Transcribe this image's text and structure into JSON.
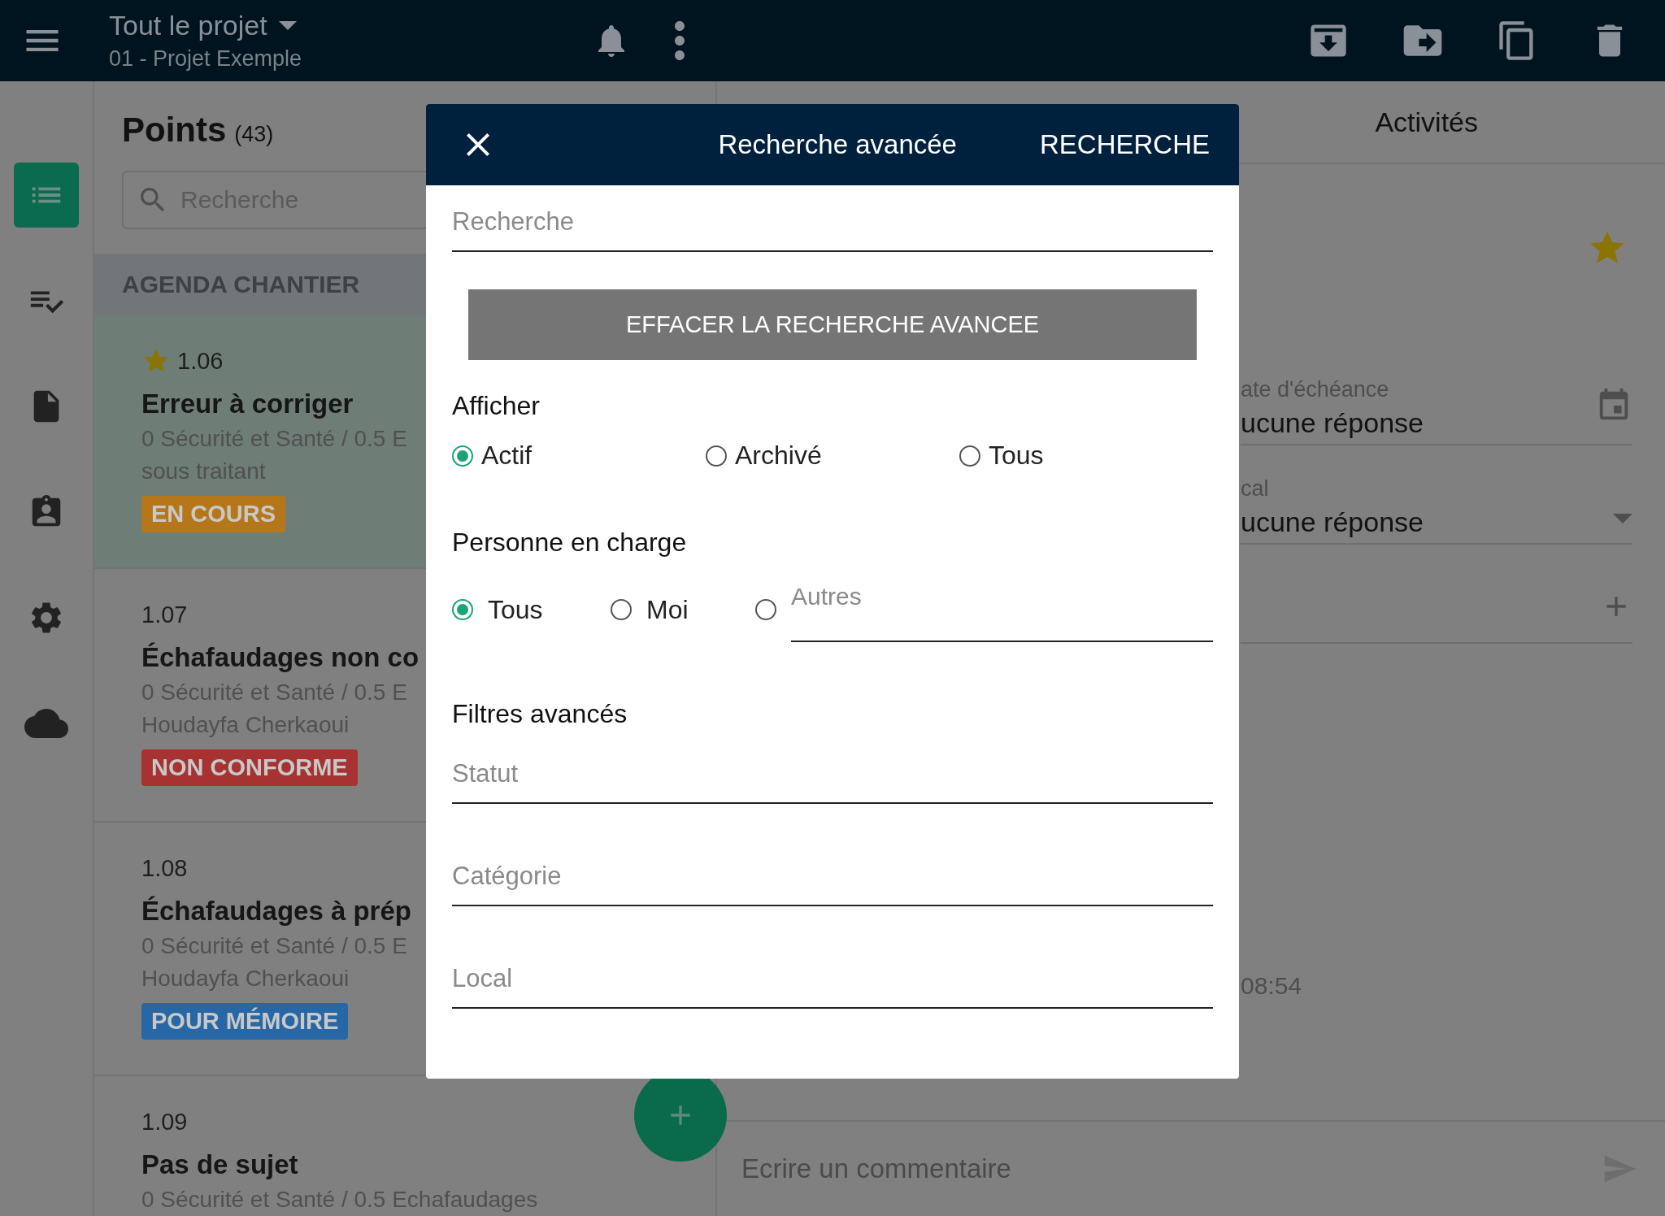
{
  "top_bar": {
    "title": "Tout le projet",
    "subtitle": "01 - Projet Exemple"
  },
  "nav_rail": {
    "items": [
      {
        "kind": "list",
        "selected": true
      },
      {
        "kind": "checklist",
        "selected": false
      },
      {
        "kind": "document",
        "selected": false
      },
      {
        "kind": "contact",
        "selected": false
      },
      {
        "kind": "settings",
        "selected": false
      },
      {
        "kind": "cloud",
        "selected": false
      }
    ]
  },
  "points": {
    "title": "Points",
    "count": "(43)",
    "search": {
      "placeholder": "Recherche"
    },
    "section": "AGENDA CHANTIER",
    "items": [
      {
        "number": "1.06",
        "starred": true,
        "selected": true,
        "title": "Erreur à corriger",
        "lines": [
          "0 Sécurité et Santé / 0.5 E",
          "sous traitant"
        ],
        "status": "EN COURS",
        "color": "#b5771a"
      },
      {
        "number": "1.07",
        "starred": false,
        "selected": false,
        "title": "Échafaudages non co",
        "lines": [
          "0 Sécurité et Santé / 0.5 E",
          "Houdayfa Cherkaoui"
        ],
        "status": "NON CONFORME",
        "color": "#a63232"
      },
      {
        "number": "1.08",
        "starred": false,
        "selected": false,
        "title": "Échafaudages à prép",
        "lines": [
          "0 Sécurité et Santé / 0.5 E",
          "Houdayfa Cherkaoui"
        ],
        "status": "POUR MÉMOIRE",
        "color": "#2767a6"
      },
      {
        "number": "1.09",
        "starred": false,
        "selected": false,
        "title": "Pas de sujet",
        "lines": [
          "0 Sécurité et Santé / 0.5 Echafaudages"
        ]
      }
    ]
  },
  "detail": {
    "tab": "Activités",
    "starred": true,
    "fields": [
      {
        "kind": "date",
        "label": "ate d'échéance",
        "value": "ucune réponse"
      },
      {
        "kind": "select",
        "label": "cal",
        "value": "ucune réponse"
      },
      {
        "kind": "add"
      }
    ],
    "timestamp": "08:54",
    "comment": {
      "placeholder": "Ecrire un commentaire"
    }
  },
  "dialog": {
    "title": "Recherche avancée",
    "action": "RECHERCHE",
    "search": {
      "placeholder": "Recherche"
    },
    "clear_button": "EFFACER LA RECHERCHE AVANCEE",
    "show": {
      "label": "Afficher",
      "options": [
        {
          "label": "Actif",
          "selected": true
        },
        {
          "label": "Archivé",
          "selected": false
        },
        {
          "label": "Tous",
          "selected": false
        }
      ]
    },
    "assignee": {
      "label": "Personne en charge",
      "options": [
        {
          "label": "Tous",
          "selected": true
        },
        {
          "label": "Moi",
          "selected": false
        },
        {
          "placeholder": "Autres",
          "selected": false
        }
      ]
    },
    "advanced": {
      "label": "Filtres avancés",
      "fields": [
        {
          "placeholder": "Statut"
        },
        {
          "placeholder": "Catégorie"
        },
        {
          "placeholder": "Local"
        }
      ]
    }
  }
}
